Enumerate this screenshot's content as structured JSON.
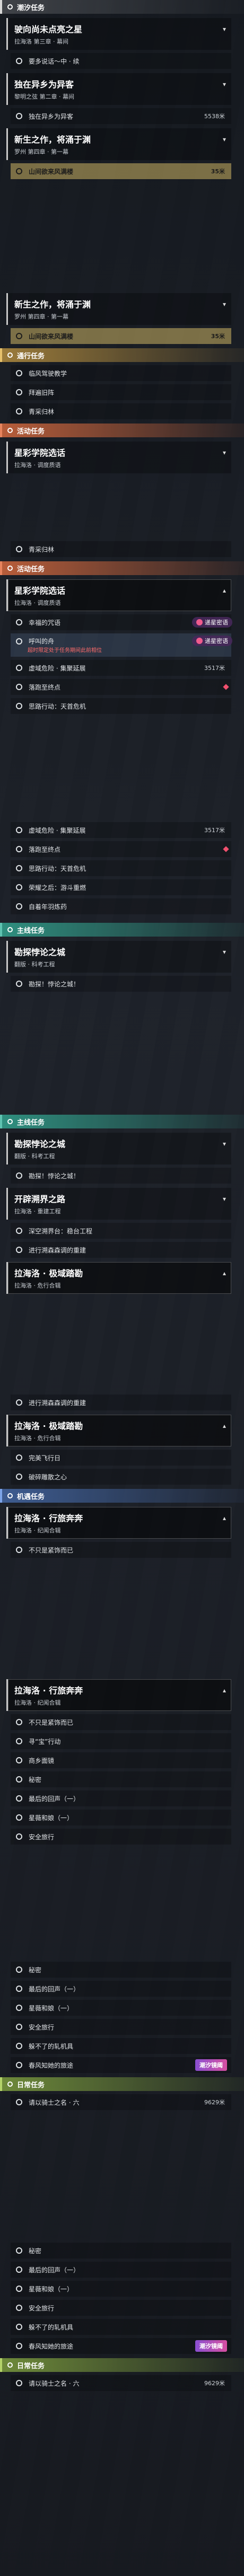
{
  "sections": {
    "chaoxi": "潮汐任务",
    "tongxing": "通行任务",
    "huodong": "活动任务",
    "zhuxian": "主线任务",
    "jiyu": "机遇任务",
    "richang": "日常任务"
  },
  "q1": {
    "title": "驶向尚未点亮之星",
    "sub": "拉海洛 第三章 · 幕间",
    "steps": [
      "要多说话～中 · 续"
    ]
  },
  "q2": {
    "title": "独在异乡为异客",
    "sub": "黎明之弦 第二章 · 幕间",
    "steps": [
      {
        "label": "独在异乡为异客",
        "dist": "5538米"
      }
    ]
  },
  "q3": {
    "title": "新生之作，将涌于渊",
    "sub": "罗州 第四章 · 第一幕",
    "steps": [
      {
        "label": "山间欲来风满楼",
        "dist": "35米"
      }
    ]
  },
  "q3b": {
    "title": "新生之作，将涌于渊",
    "sub": "罗州 第四章 · 第一幕",
    "steps": [
      {
        "label": "山间欲来风满楼",
        "dist": "35米"
      }
    ]
  },
  "tx": [
    "临风驾驶教学",
    "拜遍旧阵",
    "青采归林"
  ],
  "hd1": {
    "title": "星彩学院选话",
    "sub": "拉海洛 · 调度质语",
    "steps": [
      "青采归林"
    ]
  },
  "hd2": {
    "title": "星彩学院选话",
    "sub": "拉海洛 · 调度质语",
    "steps": [
      "幸福的咒语",
      "呼叫的舟",
      "虚域危险 · 集聚延展",
      "落跑至终点",
      "思路行动：天首危机"
    ],
    "warn": "超时限定处于任务期间此前相位",
    "dist": "3517米",
    "badge": "递星密语"
  },
  "hd3": {
    "steps": [
      "虚域危险 · 集聚延展",
      "落跑至终点",
      "思路行动：天首危机",
      "荣耀之后：游斗重燃",
      "自着年羽炼药"
    ],
    "dist": "3517米"
  },
  "zx1": {
    "title": "勘探悖论之城",
    "sub": "翻版 · 科考工程",
    "steps": [
      "勘探！悖论之城！"
    ]
  },
  "zx2": {
    "title": "勘探悖论之城",
    "sub": "翻版 · 科考工程",
    "steps": [
      "勘探！悖论之城！"
    ]
  },
  "zx3": {
    "title": "开辟溯界之路",
    "sub": "拉海洛 · 重建工程",
    "steps": [
      "深空溯界台：稳台工程",
      "进行溯森森调的重建"
    ]
  },
  "zx4": {
    "title": "拉海洛 · 极域踏勘",
    "sub": "拉海洛 · 危行合辑",
    "steps": [
      "进行溯森森调的重建"
    ]
  },
  "zx5": {
    "title": "拉海洛 · 极域踏勘",
    "sub": "拉海洛 · 危行合辑",
    "steps": [
      "完美飞行日",
      "破碎雕散之心"
    ]
  },
  "jy1": {
    "title": "拉海洛 · 行旅奔奔",
    "sub": "拉海洛 · 纪闻合辑",
    "steps": [
      "不只是紧饰而已"
    ]
  },
  "jy2": {
    "title": "拉海洛 · 行旅奔奔",
    "sub": "拉海洛 · 纪闻合辑",
    "steps": [
      "不只是紧饰而已",
      "寻“宝”行动",
      "商乡面镜",
      "秘密",
      "最后的回声（一）",
      "星薇和娘（一）",
      "安全旅行"
    ]
  },
  "jy3": {
    "steps": [
      "秘密",
      "最后的回声（一）",
      "星薇和娘（一）",
      "安全旅行",
      "躲不了的轧机具",
      "春风知她的旅途"
    ]
  },
  "rc1": {
    "step": {
      "label": "请以骑士之名 · 六",
      "dist": "9629米"
    }
  },
  "jy4": {
    "steps": [
      "秘密",
      "最后的回声（一）",
      "星薇和娘（一）",
      "安全旅行",
      "躲不了的轧机具",
      "春风知她的旅途"
    ]
  },
  "rc2": {
    "step": {
      "label": "请以骑士之名 · 六",
      "dist": "9629米"
    }
  },
  "stamp": "潮汐镜阈"
}
